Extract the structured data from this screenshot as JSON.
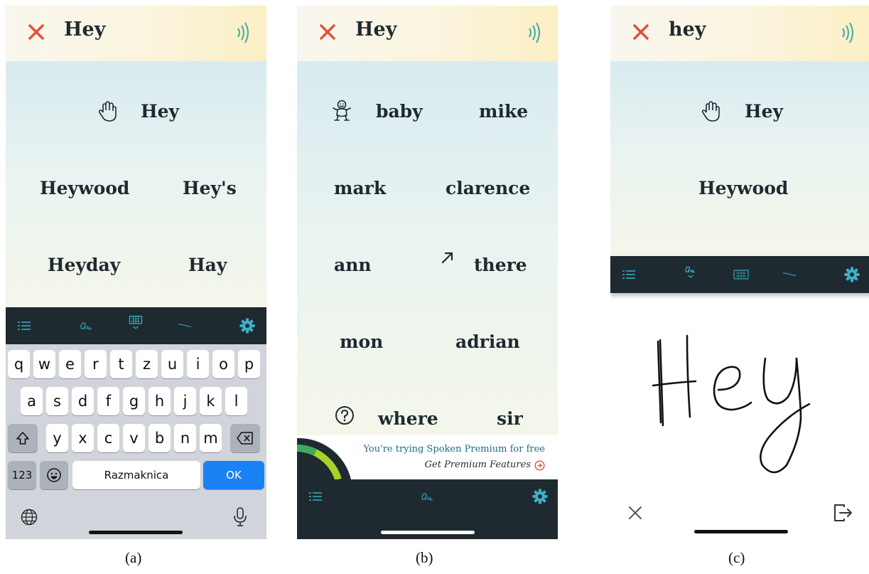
{
  "panels": {
    "a": {
      "header_word": "Hey",
      "words": [
        "Hey",
        "Heywood",
        "Hey's",
        "Heyday",
        "Hay"
      ],
      "keyboard": {
        "row1": [
          "q",
          "w",
          "e",
          "r",
          "t",
          "z",
          "u",
          "i",
          "o",
          "p"
        ],
        "row2": [
          "a",
          "s",
          "d",
          "f",
          "g",
          "h",
          "j",
          "k",
          "l"
        ],
        "row3": [
          "y",
          "x",
          "c",
          "v",
          "b",
          "n",
          "m"
        ],
        "num_label": "123",
        "space_label": "Razmaknica",
        "ok_label": "OK"
      },
      "caption": "(a)"
    },
    "b": {
      "header_word": "Hey",
      "words": [
        "baby",
        "mike",
        "mark",
        "clarence",
        "ann",
        "there",
        "mon",
        "adrian",
        "where",
        "sir"
      ],
      "promo": {
        "line1": "You're trying Spoken Premium for free",
        "line2": "Get Premium Features"
      },
      "caption": "(b)"
    },
    "c": {
      "header_word": "hey",
      "words": [
        "Hey",
        "Heywood"
      ],
      "caption": "(c)"
    }
  },
  "colors": {
    "close_red": "#e0523a",
    "toolbar_bg": "#1e2a30",
    "toolbar_icon": "#2f8fa3",
    "toolbar_icon_active": "#3fb0c8",
    "ok_blue": "#1a82f5",
    "promo_text": "#1c6f7e"
  },
  "icons": [
    "close-icon",
    "speak-icon",
    "hand-wave-icon",
    "baby-icon",
    "arrow-up-right-icon",
    "question-icon",
    "list-icon",
    "handwriting-icon",
    "keyboard-icon",
    "pencil-icon",
    "gear-icon",
    "shift-icon",
    "backspace-icon",
    "emoji-icon",
    "globe-icon",
    "microphone-icon",
    "exit-icon"
  ]
}
